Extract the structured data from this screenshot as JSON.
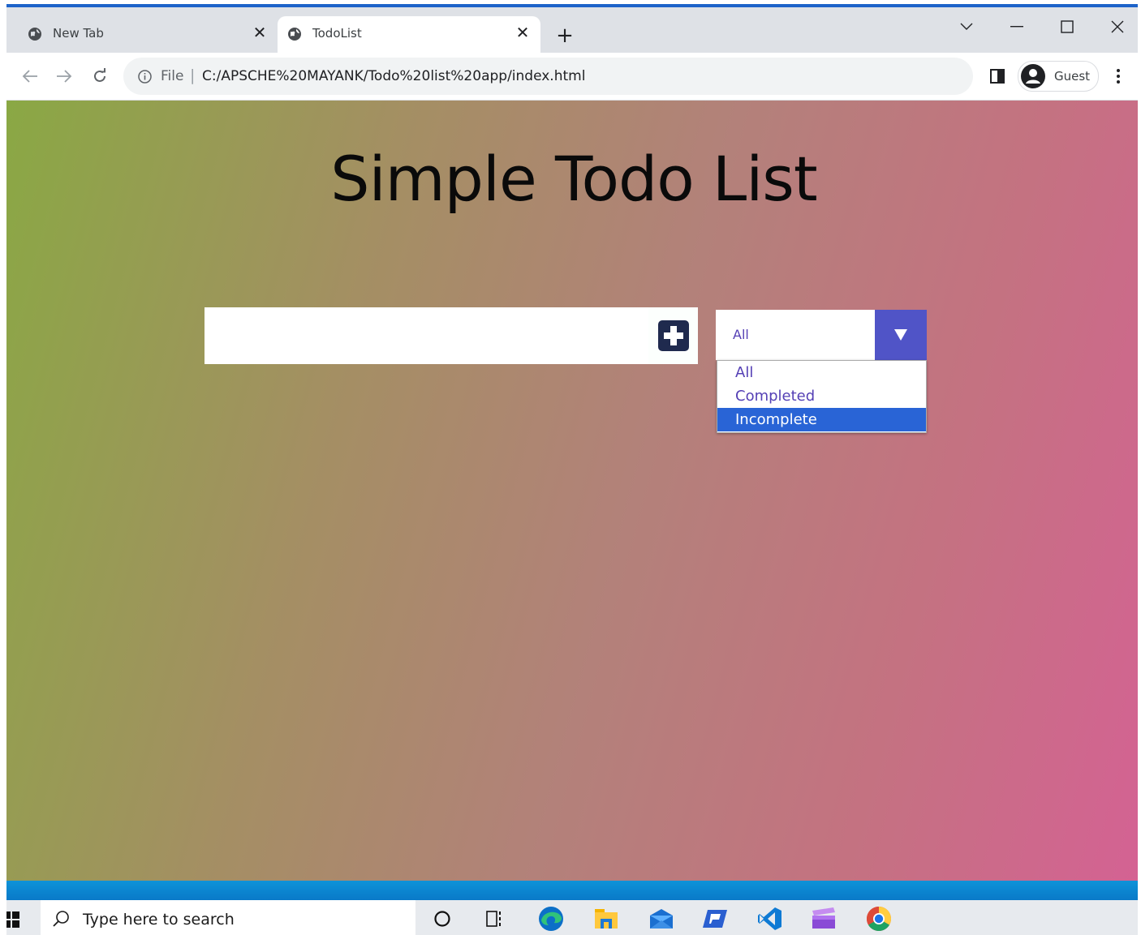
{
  "browser": {
    "tabs": [
      {
        "title": "New Tab",
        "active": false
      },
      {
        "title": "TodoList",
        "active": true
      }
    ],
    "address": {
      "scheme_label": "File",
      "separator": "|",
      "url": "C:/APSCHE%20MAYANK/Todo%20list%20app/index.html"
    },
    "profile_label": "Guest"
  },
  "page": {
    "title": "Simple Todo List",
    "todo_input": {
      "value": "",
      "placeholder": ""
    },
    "filter": {
      "selected": "All",
      "options": [
        "All",
        "Completed",
        "Incomplete"
      ],
      "highlighted": "Incomplete"
    }
  },
  "taskbar": {
    "search_placeholder": "Type here to search",
    "icons": [
      "windows-start-icon",
      "cortana-icon",
      "task-view-icon",
      "edge-icon",
      "file-explorer-icon",
      "mail-icon",
      "remote-app-icon",
      "vscode-icon",
      "clapper-app-icon",
      "chrome-icon"
    ]
  },
  "colors": {
    "gradient_start": "#8aa844",
    "gradient_end": "#d46293",
    "filter_accent": "#5054c7",
    "option_text": "#5540b5",
    "option_highlight": "#2964d6"
  }
}
